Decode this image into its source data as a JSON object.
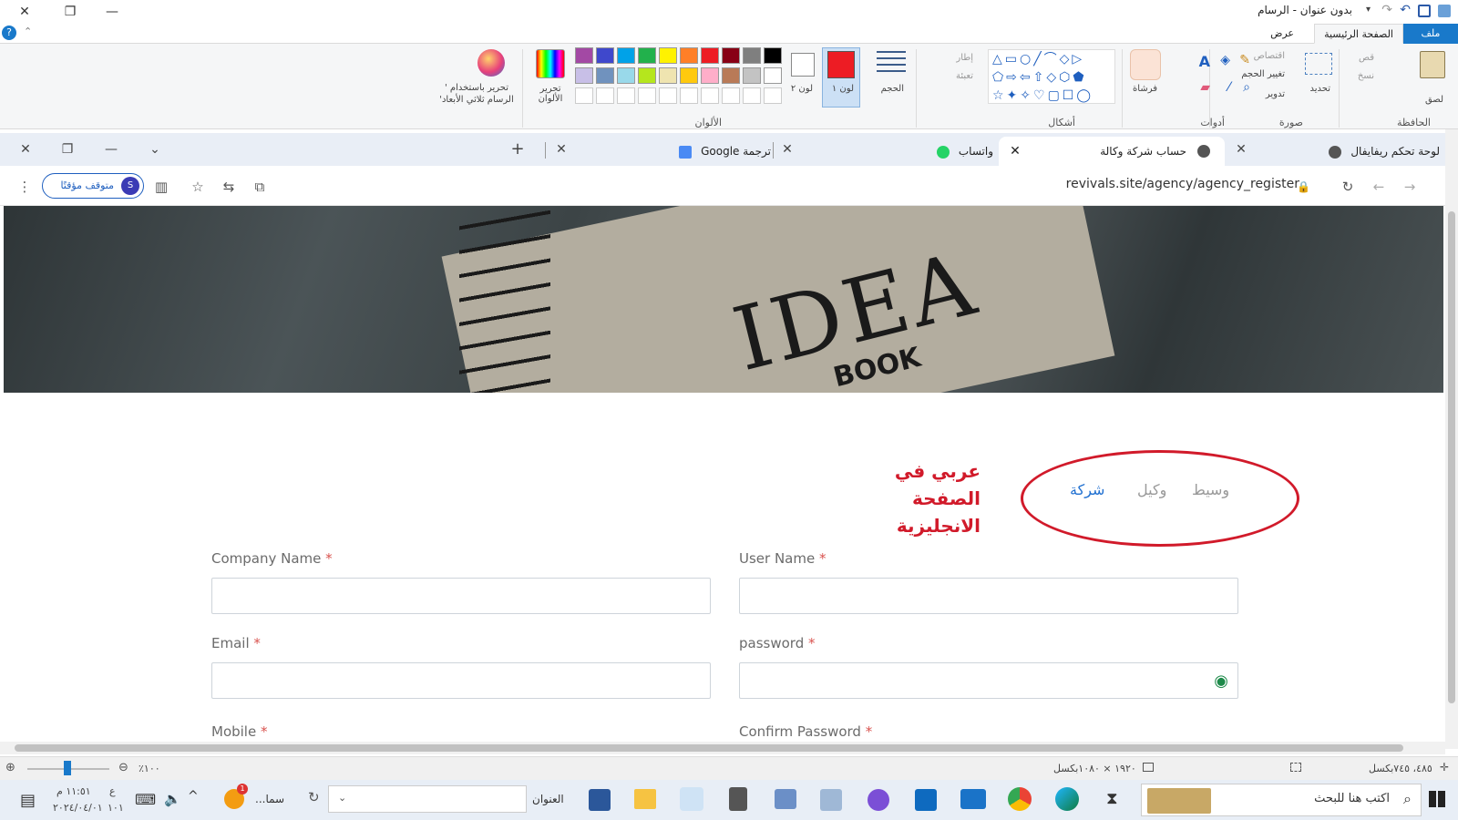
{
  "paint": {
    "title": "بدون عنوان - الرسام",
    "tabs": {
      "file": "ملف",
      "home": "الصفحة الرئيسية",
      "view": "عرض"
    },
    "groups": {
      "clipboard": "الحافظة",
      "image": "صورة",
      "tools": "أدوات",
      "shapes": "أشكال",
      "colors": "الألوان"
    },
    "clipboard": {
      "paste": "لصق",
      "cut": "قص",
      "copy": "نسخ"
    },
    "image": {
      "select": "تحديد",
      "crop": "اقتصاص",
      "resize": "تغيير الحجم",
      "rotate": "تدوير"
    },
    "brushes": "فرشاة",
    "outline": "إطار",
    "fill": "تعبئة",
    "size": "الحجم",
    "color1": "لون ١",
    "color2": "لون ٢",
    "edit_colors": "تحرير الألوان",
    "paint3d": "تحرير باستخدام ' الرسام ثلاثي الأبعاد'",
    "status": {
      "position": "٤٨٥، ٧٤٥بكسل",
      "size": "١٩٢٠ × ١٠٨٠بكسل",
      "zoom": "١٠٠٪"
    },
    "palette_row1": [
      "#000000",
      "#7f7f7f",
      "#880015",
      "#ed1c24",
      "#ff7f27",
      "#fff200",
      "#22b14c",
      "#00a2e8",
      "#3f48cc",
      "#a349a4"
    ],
    "palette_row2": [
      "#ffffff",
      "#c3c3c3",
      "#b97a57",
      "#ffaec9",
      "#ffc90e",
      "#efe4b0",
      "#b5e61d",
      "#99d9ea",
      "#7092be",
      "#c8bfe7"
    ]
  },
  "browser": {
    "tabs": [
      {
        "label": "لوحة تحكم ريفايفال"
      },
      {
        "label": "حساب شركة وكالة"
      },
      {
        "label": "واتساب"
      },
      {
        "label": "ترجمة Google"
      }
    ],
    "url": "revivals.site/agency/agency_register",
    "profile": {
      "initial": "S",
      "label": "متوقف مؤقتًا"
    }
  },
  "page": {
    "hero_text": "IDEA",
    "hero_text2": "BOOK",
    "type_tabs": [
      "وسيط",
      "وكيل",
      "شركة"
    ],
    "annotation": [
      "عربي في الصفحة",
      "الانجليزية"
    ],
    "form": {
      "company_name": "Company Name",
      "user_name": "User Name",
      "email": "Email",
      "password": "password",
      "mobile": "Mobile",
      "confirm_password": "Confirm Password",
      "required_mark": "*"
    }
  },
  "taskbar": {
    "search_placeholder": "اكتب هنا للبحث",
    "address_label": "العنوان",
    "weather_app": "سما...",
    "time": "١١:٥١ م",
    "date": "٢٠٢٤/٠٤/٠١",
    "lang": "ع",
    "lang2": "١٠١",
    "notif_count": "1"
  }
}
